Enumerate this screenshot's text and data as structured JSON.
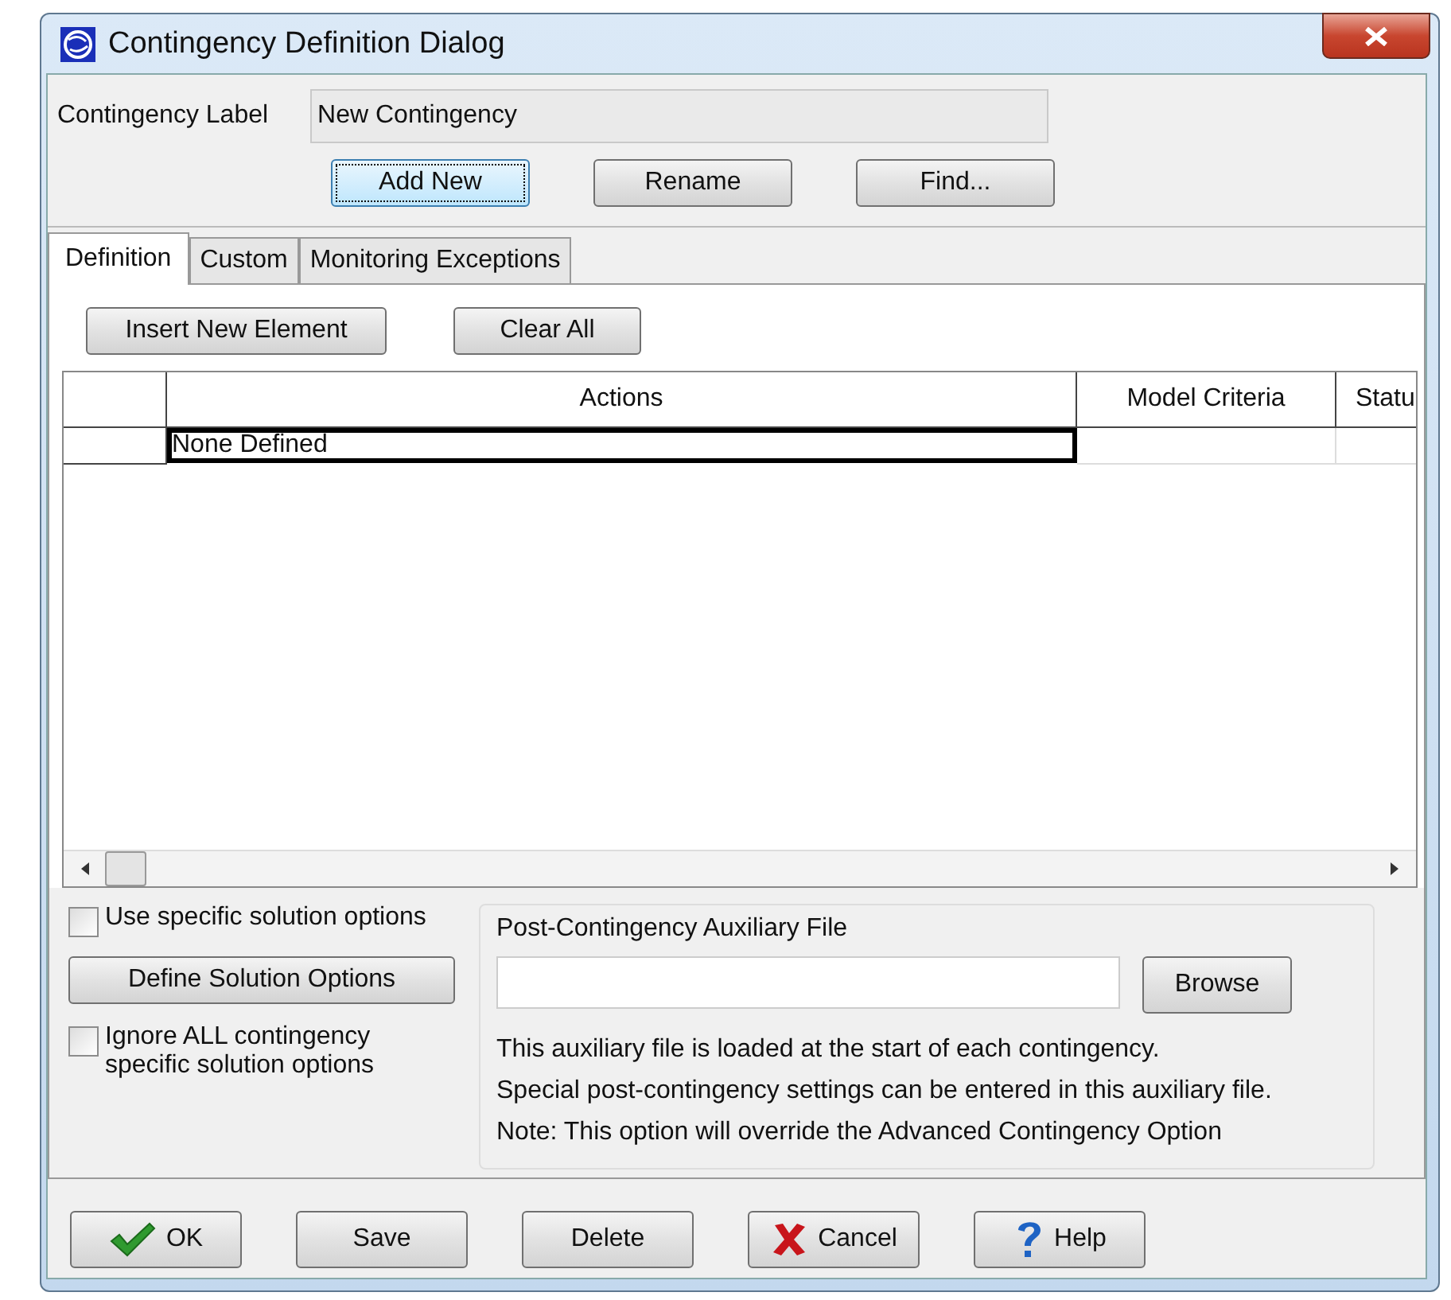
{
  "window": {
    "title": "Contingency Definition Dialog"
  },
  "label_field": {
    "label": "Contingency Label",
    "value": "New Contingency"
  },
  "top_buttons": [
    {
      "label": "Add New",
      "focused": true
    },
    {
      "label": "Rename",
      "focused": false
    },
    {
      "label": "Find...",
      "focused": false
    }
  ],
  "tabs": [
    {
      "label": "Definition",
      "selected": true
    },
    {
      "label": "Custom",
      "selected": false
    },
    {
      "label": "Monitoring Exceptions",
      "selected": false
    }
  ],
  "table_buttons": [
    "Insert New Element",
    "Clear All"
  ],
  "table": {
    "columns": [
      "Actions",
      "Model Criteria",
      "Statu"
    ],
    "rows": [
      {
        "actions": "None Defined",
        "focused": true
      }
    ]
  },
  "options": {
    "use_specific": {
      "label": "Use specific solution options",
      "checked": false
    },
    "define_button": "Define Solution Options",
    "ignore_all": {
      "label": "Ignore ALL contingency specific solution options",
      "checked": false
    }
  },
  "aux_file": {
    "title": "Post-Contingency Auxiliary File",
    "browse_button": "Browse",
    "notes": [
      "This auxiliary file is loaded at the start of each contingency.",
      "Special post-contingency settings can be entered in this auxiliary file.",
      "Note: This option will override the Advanced Contingency Option"
    ]
  },
  "footer_buttons": [
    {
      "label": "OK",
      "kind": "check"
    },
    {
      "label": "Save",
      "kind": "plain"
    },
    {
      "label": "Delete",
      "kind": "plain"
    },
    {
      "label": "Cancel",
      "kind": "cross"
    },
    {
      "label": "Help",
      "kind": "help"
    }
  ]
}
